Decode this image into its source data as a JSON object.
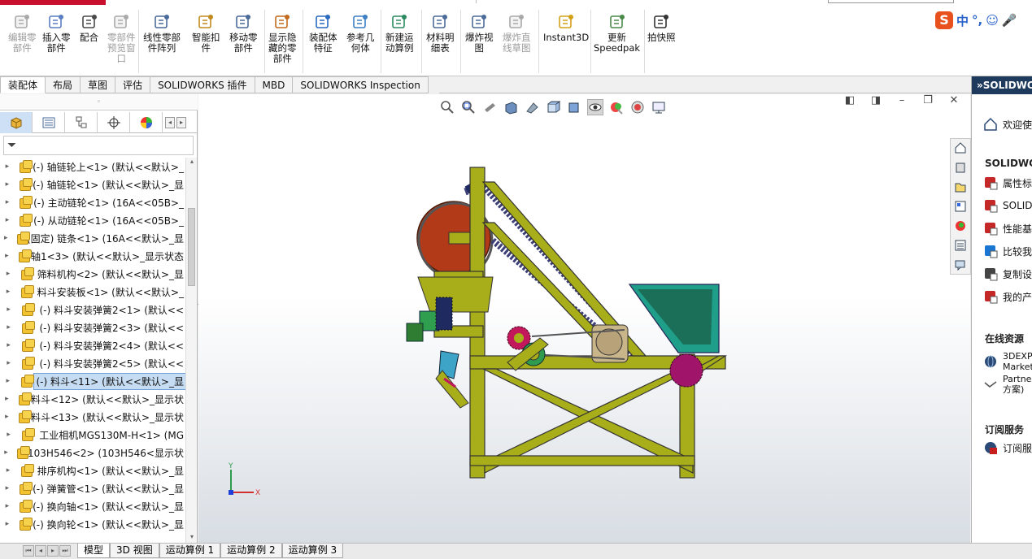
{
  "ribbon": {
    "buttons": [
      {
        "label": "编辑零\n部件",
        "enabled": false
      },
      {
        "label": "插入零\n部件",
        "enabled": true
      },
      {
        "label": "配合",
        "enabled": true
      },
      {
        "label": "零部件\n预览窗\n口",
        "enabled": false
      },
      {
        "label": "线性零部\n件阵列",
        "enabled": true
      },
      {
        "label": "智能扣\n件",
        "enabled": true
      },
      {
        "label": "移动零\n部件",
        "enabled": true
      },
      {
        "label": "显示隐\n藏的零\n部件",
        "enabled": true
      },
      {
        "label": "装配体\n特征",
        "enabled": true
      },
      {
        "label": "参考几\n何体",
        "enabled": true
      },
      {
        "label": "新建运\n动算例",
        "enabled": true
      },
      {
        "label": "材料明\n细表",
        "enabled": true
      },
      {
        "label": "爆炸视\n图",
        "enabled": true
      },
      {
        "label": "爆炸直\n线草图",
        "enabled": false
      },
      {
        "label": "Instant3D",
        "enabled": true
      },
      {
        "label": "更新\nSpeedpak",
        "enabled": true
      },
      {
        "label": "拍快照",
        "enabled": true
      }
    ]
  },
  "ime": {
    "logo": "S",
    "mode": "中"
  },
  "tabs": [
    "装配体",
    "布局",
    "草图",
    "评估",
    "SOLIDWORKS 插件",
    "MBD",
    "SOLIDWORKS Inspection"
  ],
  "active_tab": "装配体",
  "tree": {
    "items": [
      "(-) 轴链轮上<1> (默认<<默认>_",
      "(-) 轴链轮<1> (默认<<默认>_显",
      "(-) 主动链轮<1> (16A<<05B>_",
      "(-) 从动链轮<1> (16A<<05B>_",
      "(固定) 链条<1> (16A<<默认>_显",
      "轴1<3> (默认<<默认>_显示状态",
      "筛料机构<2> (默认<<默认>_显",
      "料斗安装板<1> (默认<<默认>_",
      "(-) 料斗安装弹簧2<1> (默认<<",
      "(-) 料斗安装弹簧2<3> (默认<<",
      "(-) 料斗安装弹簧2<4> (默认<<",
      "(-) 料斗安装弹簧2<5> (默认<<",
      "(-) 料斗<11> (默认<<默认>_显",
      "料斗<12> (默认<<默认>_显示状",
      "料斗<13> (默认<<默认>_显示状",
      "工业相机MGS130M-H<1> (MG",
      "103H546<2> (103H546<显示状",
      "排序机构<1> (默认<<默认>_显",
      "(-) 弹簧管<1> (默认<<默认>_显",
      "(-) 换向轴<1> (默认<<默认>_显",
      "(-) 换向轮<1> (默认<<默认>_显"
    ],
    "selected_index": 12
  },
  "triad": {
    "y": "Y",
    "x": "X"
  },
  "right_panel": {
    "header": "SOLIDWORKS",
    "welcome": "欢迎使",
    "section1_title": "SOLIDWORKS",
    "items": [
      "属性标",
      "SOLIDV",
      "性能基",
      "比较我",
      "复制设",
      "我的产"
    ],
    "online_title": "在线资源",
    "online_items": [
      "3DEXPE\nMarket",
      "Partner\n方案)"
    ],
    "sub_title": "订阅服务",
    "sub_item": "订阅服"
  },
  "bottom_tabs": [
    "模型",
    "3D 视图",
    "运动算例 1",
    "运动算例 2",
    "运动算例 3"
  ],
  "active_bottom_tab": "模型",
  "colors": {
    "frame": "#a8ad1a",
    "chain": "#3c3f78",
    "hopper": "#1f9e8a",
    "wheel": "#b33a18",
    "accent_blue": "#1e3a5c"
  }
}
